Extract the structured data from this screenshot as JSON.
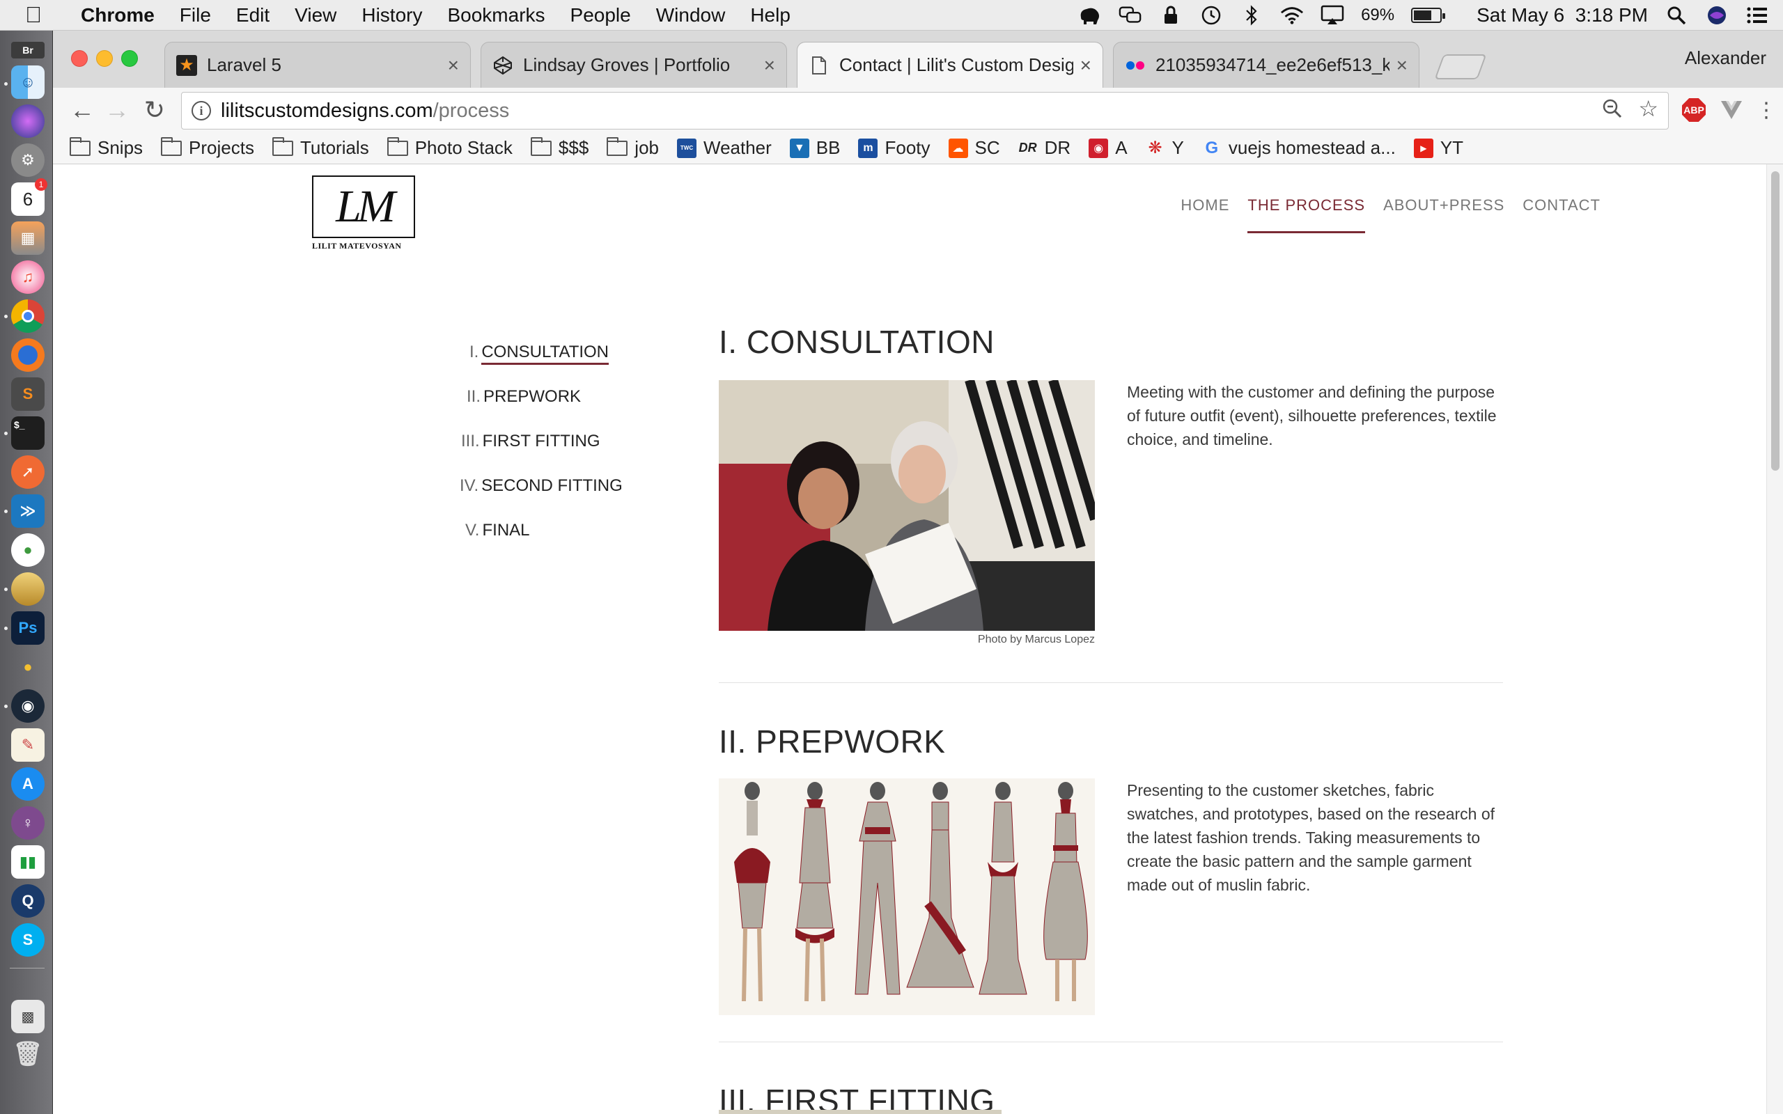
{
  "menubar": {
    "app_name": "Chrome",
    "items": [
      "File",
      "Edit",
      "View",
      "History",
      "Bookmarks",
      "People",
      "Window",
      "Help"
    ],
    "battery_percent": "69%",
    "battery_level": 0.69,
    "clock": "Sat May 6  3:18 PM"
  },
  "dock": {
    "calendar_day": "6",
    "calendar_badge": "1"
  },
  "browser": {
    "tabs": [
      {
        "title": "Laravel 5",
        "icon": "laravel-star-icon"
      },
      {
        "title": "Lindsay Groves | Portfolio",
        "icon": "codepen-icon"
      },
      {
        "title": "Contact | Lilit's Custom Design",
        "icon": "page-icon"
      },
      {
        "title": "21035934714_ee2e6ef513_k",
        "icon": "flickr-icon"
      }
    ],
    "profile_name": "Alexander",
    "url_host": "lilitscustomdesigns.com",
    "url_path": "/process",
    "bookmarks": [
      {
        "label": "Snips",
        "type": "folder"
      },
      {
        "label": "Projects",
        "type": "folder"
      },
      {
        "label": "Tutorials",
        "type": "folder"
      },
      {
        "label": "Photo Stack",
        "type": "folder"
      },
      {
        "label": "$$$",
        "type": "folder"
      },
      {
        "label": "job",
        "type": "folder"
      },
      {
        "label": "Weather",
        "type": "site",
        "color": "#1d4f9c"
      },
      {
        "label": "BB",
        "type": "site",
        "color": "#1a6fb5"
      },
      {
        "label": "Footy",
        "type": "site",
        "color": "#1b4fa0"
      },
      {
        "label": "SC",
        "type": "site",
        "color": "#ff5500"
      },
      {
        "label": "DR",
        "type": "site",
        "color": "#222222"
      },
      {
        "label": "A",
        "type": "site",
        "color": "#d0202e"
      },
      {
        "label": "Y",
        "type": "site",
        "color": "#d32323"
      },
      {
        "label": "vuejs homestead a...",
        "type": "site",
        "color": "#4285f4"
      },
      {
        "label": "YT",
        "type": "site",
        "color": "#e62117"
      }
    ],
    "extensions": {
      "abp_label": "ABP"
    }
  },
  "site": {
    "logo_letters": "LM",
    "logo_caption": "LILIT MATEVOSYAN",
    "nav": [
      "HOME",
      "THE PROCESS",
      "ABOUT+PRESS",
      "CONTACT"
    ],
    "active_nav": "THE PROCESS",
    "accent": "#7a2a34",
    "side_nav": [
      {
        "num": "I.",
        "label": "CONSULTATION"
      },
      {
        "num": "II.",
        "label": "PREPWORK"
      },
      {
        "num": "III.",
        "label": "FIRST FITTING"
      },
      {
        "num": "IV.",
        "label": "SECOND FITTING"
      },
      {
        "num": "V.",
        "label": "FINAL"
      }
    ],
    "sections": [
      {
        "title": "I. CONSULTATION",
        "text": "Meeting with the customer and defining the purpose of future outfit (event), silhouette preferences, textile choice, and timeline.",
        "photo_credit": "Photo by Marcus Lopez"
      },
      {
        "title": "II. PREPWORK",
        "text": "Presenting to the customer sketches, fabric swatches, and prototypes, based on the research of the latest fashion trends. Taking measurements to create the basic pattern and the sample garment made out of muslin fabric."
      },
      {
        "title": "III. FIRST FITTING"
      }
    ]
  }
}
